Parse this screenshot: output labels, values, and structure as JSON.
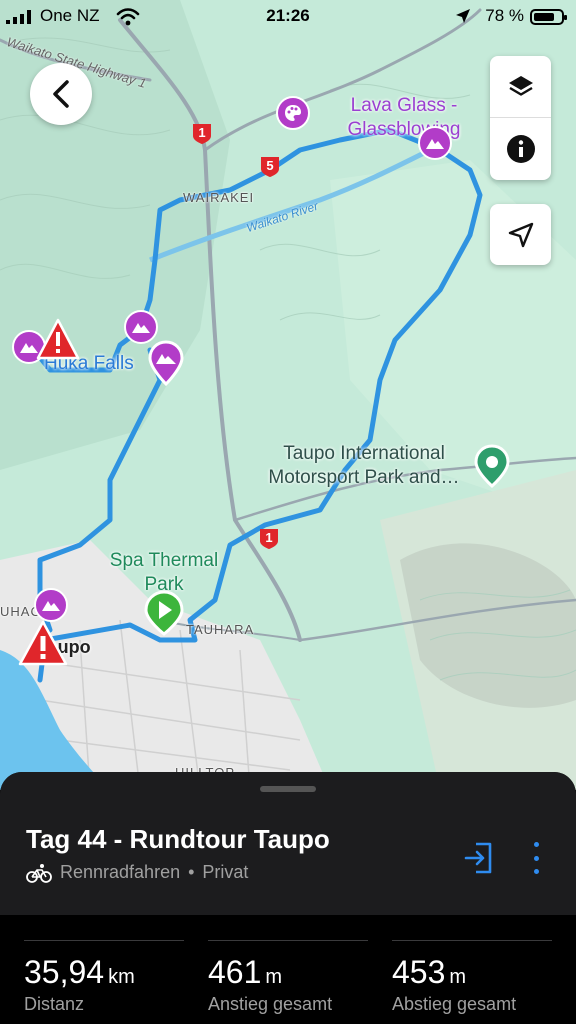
{
  "status_bar": {
    "carrier": "One NZ",
    "time": "21:26",
    "battery_percent": "78 %",
    "battery_level": 0.78
  },
  "map": {
    "labels": {
      "highway_1_name": "Waikato State Highway 1",
      "wairakei": "WAIRAKEI",
      "waikato_river": "Waikato River",
      "lava_glass": "Lava Glass - Glassblowing Studio",
      "huka_falls": "Huka Falls",
      "motorsport": "Taupo International Motorsport Park and…",
      "spa_thermal": "Spa Thermal Park",
      "tauhara": "TAUHARA",
      "taupo": "Taupo",
      "richmond_heights": "UHAC",
      "hilltop": "HILLTOP"
    },
    "road_shields": [
      "1",
      "5",
      "1"
    ],
    "colors": {
      "route": "#2f93e0",
      "poi_purple": "#b23cc8",
      "start_green": "#3db53c",
      "warning_red": "#e0262b",
      "lake": "#6cc3ee"
    }
  },
  "controls": {
    "back": "chevron-left-icon",
    "layers": "layers-icon",
    "info": "info-icon",
    "locate": "navigation-arrow-icon"
  },
  "sheet": {
    "title": "Tag 44 - Rundtour Taupo",
    "activity": "Rennradfahren",
    "separator": "•",
    "visibility": "Privat",
    "stats": [
      {
        "value": "35,94",
        "unit": "km",
        "label": "Distanz"
      },
      {
        "value": "461",
        "unit": "m",
        "label": "Anstieg gesamt"
      },
      {
        "value": "453",
        "unit": "m",
        "label": "Abstieg gesamt"
      }
    ]
  }
}
